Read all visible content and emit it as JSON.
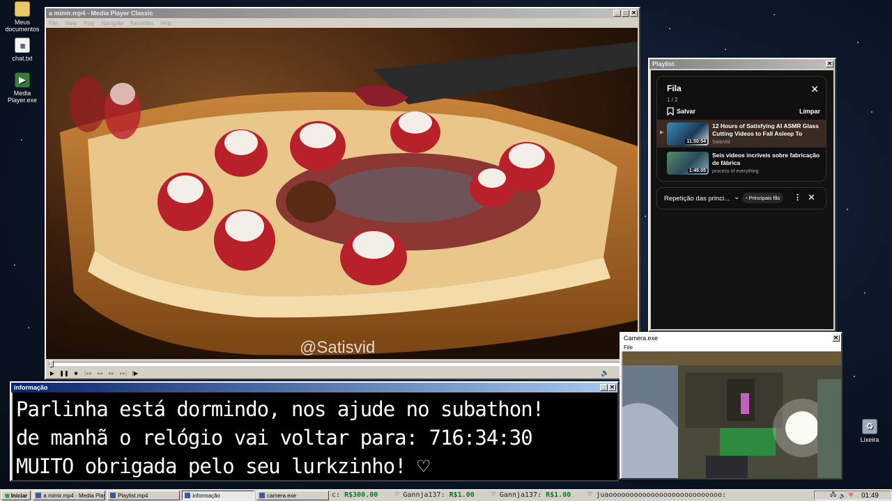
{
  "desktop": {
    "icons": [
      {
        "label": "Meus documentos",
        "icon": "folder-icon"
      },
      {
        "label": "chat.txt",
        "icon": "text-file-icon"
      },
      {
        "label": "Media Player.exe",
        "icon": "media-player-icon"
      },
      {
        "label": "Lixeira",
        "icon": "recycle-bin-icon"
      }
    ]
  },
  "player": {
    "title": "a mimir.mp4 - Media Player Classic",
    "menu": [
      "File",
      "View",
      "Play",
      "Navigate",
      "Favorites",
      "Help"
    ],
    "watermark": "@Satisvid",
    "progress": 0.0
  },
  "playlist_window": {
    "title": "Playlist",
    "queue_title": "Fila",
    "queue_count": "1 / 2",
    "save_label": "Salvar",
    "clear_label": "Limpar",
    "videos": [
      {
        "title": "12 Hours of Satisfying AI ASMR Glass Cutting Videos to Fall Asleep To",
        "duration": "11:50:54",
        "channel": "SatisVid",
        "active": true
      },
      {
        "title": "Seis vídeos incríveis sobre fabricação de fábrica",
        "duration": "1:45:05",
        "channel": "process of everything",
        "active": false
      }
    ],
    "repeat_label": "Repetição das princi...",
    "badge_label": "Principais fãs"
  },
  "info_window": {
    "title": "informação",
    "lines": [
      "Parlinha está dormindo, nos ajude no subathon!",
      "de manhã o relógio vai voltar para:  716:34:30",
      "MUITO obrigada pelo seu lurkzinho! ♡"
    ]
  },
  "camera_window": {
    "title": "Camera.exe",
    "menu": [
      "File"
    ]
  },
  "taskbar": {
    "start_label": "Iniciar",
    "tasks": [
      {
        "label": "a mimir.mp4 - Media Player...",
        "active": false
      },
      {
        "label": "Playlist.mp4",
        "active": false
      },
      {
        "label": "informação",
        "active": true
      },
      {
        "label": "camera.exe",
        "active": false
      }
    ],
    "ticker": [
      {
        "prefix": "c:",
        "amount": "R$300.00"
      },
      {
        "prefix": "♡ Gannja137:",
        "amount": "R$1.00"
      },
      {
        "prefix": "♡ Gannja137:",
        "amount": "R$1.00"
      },
      {
        "prefix": "♡ juaooooooooooooooooooooooooooo:",
        "amount": ""
      }
    ],
    "clock": "01:49"
  }
}
